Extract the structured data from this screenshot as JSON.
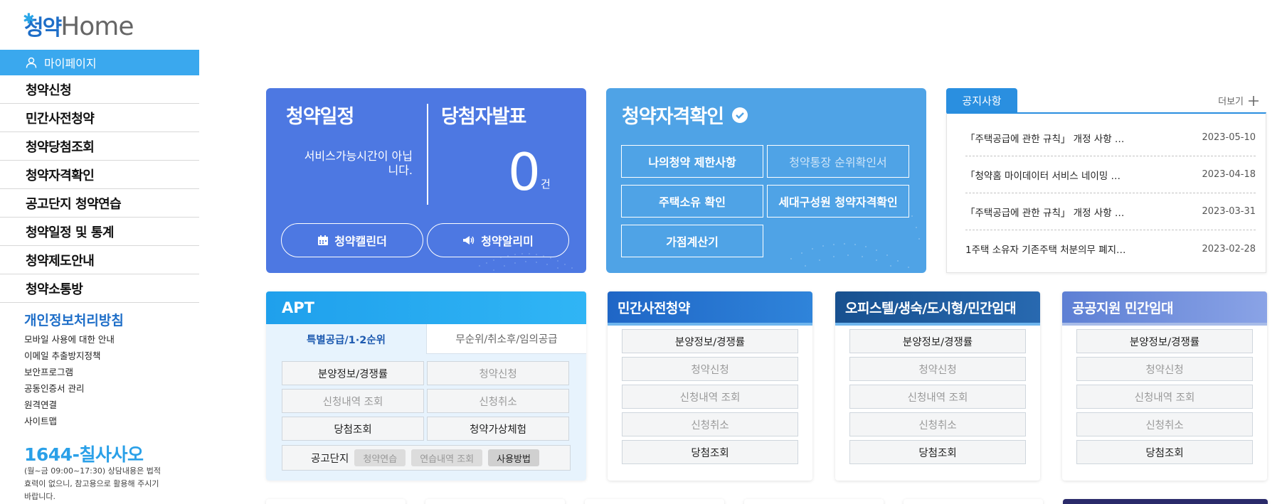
{
  "logo": {
    "korean": "청약",
    "english": "Home"
  },
  "sidebar": {
    "mypage": "마이페이지",
    "nav": [
      "청약신청",
      "민간사전청약",
      "청약당첨조회",
      "청약자격확인",
      "공고단지 청약연습",
      "청약일정 및 통계",
      "청약제도안내",
      "청약소통방"
    ],
    "policy_title": "개인정보처리방침",
    "policy_links": [
      "모바일 사용에 대한 안내",
      "이메일 추출방지정책",
      "보안프로그램",
      "공동인증서 관리",
      "원격연결",
      "사이트맵"
    ],
    "phone": "1644-칠사사오",
    "phone_note": "(월~금 09:00~17:30) 상담내용은 법적효력이 없으니, 참고용으로 활용해 주시기 바랍니다."
  },
  "schedule_card": {
    "title_left": "청약일정",
    "title_right": "당첨자발표",
    "service_msg": "서비스가능시간이 아닙니다.",
    "count": "0",
    "unit": "건",
    "calendar_btn": "청약캘린더",
    "alarm_btn": "청약알리미"
  },
  "qualify_card": {
    "title": "청약자격확인",
    "buttons": [
      {
        "label": "나의청약 제한사항",
        "enabled": true
      },
      {
        "label": "청약통장 순위확인서",
        "enabled": false
      },
      {
        "label": "주택소유 확인",
        "enabled": true
      },
      {
        "label": "세대구성원 청약자격확인",
        "enabled": true
      },
      {
        "label": "가점계산기",
        "enabled": true
      }
    ]
  },
  "notice": {
    "tab": "공지사항",
    "more": "더보기",
    "items": [
      {
        "title": "「주택공급에 관한 규칙」 개정 사항 …",
        "date": "2023-05-10"
      },
      {
        "title": "「청약홈 마이데이터 서비스 네이밍 …",
        "date": "2023-04-18"
      },
      {
        "title": "「주택공급에 관한 규칙」 개정 사항 …",
        "date": "2023-03-31"
      },
      {
        "title": "1주택 소유자 기존주택 처분의무 폐지…",
        "date": "2023-02-28"
      }
    ]
  },
  "apt": {
    "title": "APT",
    "tab_active": "특별공급/1·2순위",
    "tab_inactive": "무순위/취소후/임의공급",
    "buttons": [
      {
        "label": "분양정보/경쟁률",
        "enabled": true
      },
      {
        "label": "청약신청",
        "enabled": false
      },
      {
        "label": "신청내역 조회",
        "enabled": false
      },
      {
        "label": "신청취소",
        "enabled": false
      },
      {
        "label": "당첨조회",
        "enabled": true
      },
      {
        "label": "청약가상체험",
        "enabled": true
      }
    ],
    "gongo_label": "공고단지",
    "gongo_chips": [
      {
        "label": "청약연습",
        "enabled": false
      },
      {
        "label": "연습내역 조회",
        "enabled": false
      },
      {
        "label": "사용방법",
        "enabled": true
      }
    ]
  },
  "cards": [
    {
      "title": "민간사전청약",
      "items": [
        {
          "label": "분양정보/경쟁률",
          "enabled": true
        },
        {
          "label": "청약신청",
          "enabled": false
        },
        {
          "label": "신청내역 조회",
          "enabled": false
        },
        {
          "label": "신청취소",
          "enabled": false
        },
        {
          "label": "당첨조회",
          "enabled": true
        }
      ]
    },
    {
      "title": "오피스텔/생숙/도시형/민간임대",
      "items": [
        {
          "label": "분양정보/경쟁률",
          "enabled": true
        },
        {
          "label": "청약신청",
          "enabled": false
        },
        {
          "label": "신청내역 조회",
          "enabled": false
        },
        {
          "label": "신청취소",
          "enabled": false
        },
        {
          "label": "당첨조회",
          "enabled": true
        }
      ]
    },
    {
      "title": "공공지원 민간임대",
      "items": [
        {
          "label": "분양정보/경쟁률",
          "enabled": true
        },
        {
          "label": "청약신청",
          "enabled": false
        },
        {
          "label": "신청내역 조회",
          "enabled": false
        },
        {
          "label": "신청취소",
          "enabled": false
        },
        {
          "label": "당첨조회",
          "enabled": true
        }
      ]
    }
  ],
  "colors": {
    "brand_blue": "#1e6ec8",
    "sidebar_active": "#3aa8ee",
    "schedule_card": "#4d78e2",
    "qualify_card": "#4fa3e6",
    "notice_tab": "#2a8fe0"
  }
}
